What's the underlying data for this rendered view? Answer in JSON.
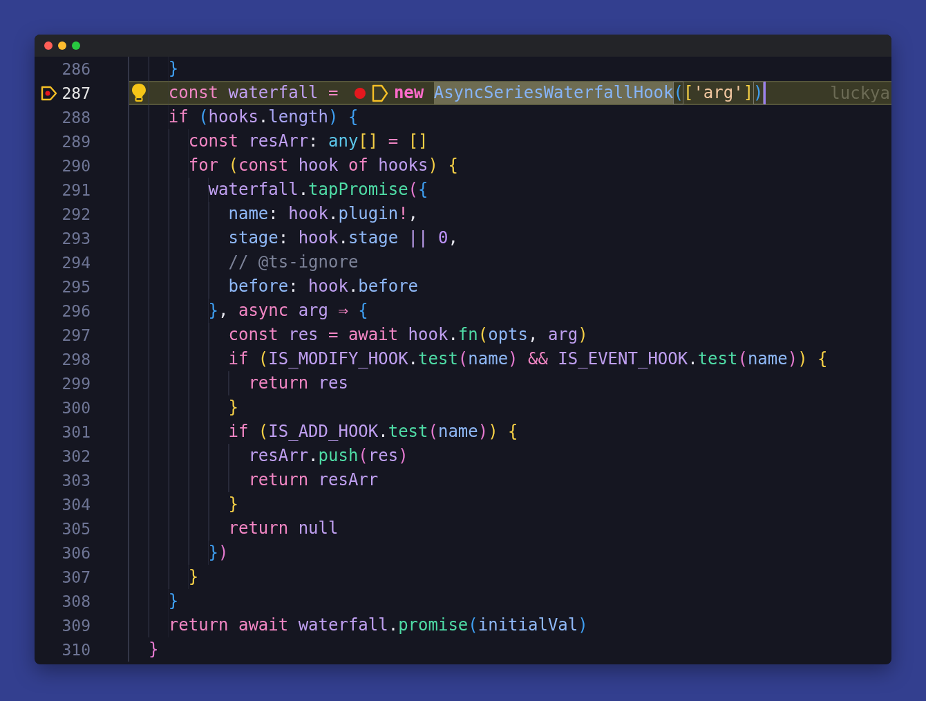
{
  "window": {
    "controls": [
      {
        "kind": "close"
      },
      {
        "kind": "minimize"
      },
      {
        "kind": "maximize"
      }
    ]
  },
  "editor": {
    "lines": [
      {
        "number": "286",
        "current": false,
        "tokens": [
          {
            "text": "    }",
            "kind": "b3"
          }
        ]
      },
      {
        "number": "287",
        "current": true,
        "breakpoint": true,
        "lightbulb": true,
        "blame": "luckya",
        "tokens": [
          {
            "text": "    const ",
            "kind": "kw"
          },
          {
            "text": "waterfall ",
            "kind": "var"
          },
          {
            "text": "= ",
            "kind": "op"
          },
          {
            "kind": "breakpoint-dot"
          },
          {
            "kind": "tag-marker"
          },
          {
            "text": "new ",
            "kind": "new"
          },
          {
            "text": "AsyncSeriesWaterfallHook",
            "kind": "cls",
            "selected": true
          },
          {
            "text": "(",
            "kind": "b3",
            "matched": true
          },
          {
            "text": "[",
            "kind": "b1"
          },
          {
            "text": "'arg'",
            "kind": "str"
          },
          {
            "text": "]",
            "kind": "b1"
          },
          {
            "text": ")",
            "kind": "b3",
            "matched": true,
            "cursor": true
          }
        ]
      },
      {
        "number": "288",
        "current": false,
        "tokens": [
          {
            "text": "    if ",
            "kind": "kw"
          },
          {
            "text": "(",
            "kind": "b3"
          },
          {
            "text": "hooks",
            "kind": "var"
          },
          {
            "text": ".",
            "kind": "p"
          },
          {
            "text": "length",
            "kind": "prop"
          },
          {
            "text": ") ",
            "kind": "b3"
          },
          {
            "text": "{",
            "kind": "b3"
          }
        ]
      },
      {
        "number": "289",
        "current": false,
        "tokens": [
          {
            "text": "      const ",
            "kind": "kw"
          },
          {
            "text": "resArr",
            "kind": "var"
          },
          {
            "text": ": ",
            "kind": "p"
          },
          {
            "text": "any",
            "kind": "type"
          },
          {
            "text": "[] ",
            "kind": "b1"
          },
          {
            "text": "= ",
            "kind": "op"
          },
          {
            "text": "[]",
            "kind": "b1"
          }
        ]
      },
      {
        "number": "290",
        "current": false,
        "tokens": [
          {
            "text": "      for ",
            "kind": "kw"
          },
          {
            "text": "(",
            "kind": "b1"
          },
          {
            "text": "const ",
            "kind": "kw"
          },
          {
            "text": "hook ",
            "kind": "var"
          },
          {
            "text": "of ",
            "kind": "kw"
          },
          {
            "text": "hooks",
            "kind": "var"
          },
          {
            "text": ") ",
            "kind": "b1"
          },
          {
            "text": "{",
            "kind": "b1"
          }
        ]
      },
      {
        "number": "291",
        "current": false,
        "tokens": [
          {
            "text": "        waterfall",
            "kind": "var"
          },
          {
            "text": ".",
            "kind": "p"
          },
          {
            "text": "tapPromise",
            "kind": "fn"
          },
          {
            "text": "(",
            "kind": "b2"
          },
          {
            "text": "{",
            "kind": "b3"
          }
        ]
      },
      {
        "number": "292",
        "current": false,
        "tokens": [
          {
            "text": "          name",
            "kind": "key"
          },
          {
            "text": ": ",
            "kind": "p"
          },
          {
            "text": "hook",
            "kind": "var"
          },
          {
            "text": ".",
            "kind": "p"
          },
          {
            "text": "plugin",
            "kind": "key"
          },
          {
            "text": "!",
            "kind": "op"
          },
          {
            "text": ",",
            "kind": "p"
          }
        ]
      },
      {
        "number": "293",
        "current": false,
        "tokens": [
          {
            "text": "          stage",
            "kind": "key"
          },
          {
            "text": ": ",
            "kind": "p"
          },
          {
            "text": "hook",
            "kind": "var"
          },
          {
            "text": ".",
            "kind": "p"
          },
          {
            "text": "stage ",
            "kind": "key"
          },
          {
            "text": "|| ",
            "kind": "var"
          },
          {
            "text": "0",
            "kind": "num"
          },
          {
            "text": ",",
            "kind": "p"
          }
        ]
      },
      {
        "number": "294",
        "current": false,
        "tokens": [
          {
            "text": "          // @ts-ignore",
            "kind": "cmt"
          }
        ]
      },
      {
        "number": "295",
        "current": false,
        "tokens": [
          {
            "text": "          before",
            "kind": "key"
          },
          {
            "text": ": ",
            "kind": "p"
          },
          {
            "text": "hook",
            "kind": "var"
          },
          {
            "text": ".",
            "kind": "p"
          },
          {
            "text": "before",
            "kind": "key"
          }
        ]
      },
      {
        "number": "296",
        "current": false,
        "tokens": [
          {
            "text": "        }",
            "kind": "b3"
          },
          {
            "text": ", ",
            "kind": "p"
          },
          {
            "text": "async ",
            "kind": "kw"
          },
          {
            "text": "arg ",
            "kind": "var"
          },
          {
            "text": "⇒ ",
            "kind": "op"
          },
          {
            "text": "{",
            "kind": "b3"
          }
        ]
      },
      {
        "number": "297",
        "current": false,
        "tokens": [
          {
            "text": "          const ",
            "kind": "kw"
          },
          {
            "text": "res ",
            "kind": "var"
          },
          {
            "text": "= ",
            "kind": "op"
          },
          {
            "text": "await ",
            "kind": "kw"
          },
          {
            "text": "hook",
            "kind": "var"
          },
          {
            "text": ".",
            "kind": "p"
          },
          {
            "text": "fn",
            "kind": "fn"
          },
          {
            "text": "(",
            "kind": "b1"
          },
          {
            "text": "opts",
            "kind": "key"
          },
          {
            "text": ", ",
            "kind": "p"
          },
          {
            "text": "arg",
            "kind": "var"
          },
          {
            "text": ")",
            "kind": "b1"
          }
        ]
      },
      {
        "number": "298",
        "current": false,
        "tokens": [
          {
            "text": "          if ",
            "kind": "kw"
          },
          {
            "text": "(",
            "kind": "b1"
          },
          {
            "text": "IS_MODIFY_HOOK",
            "kind": "var"
          },
          {
            "text": ".",
            "kind": "p"
          },
          {
            "text": "test",
            "kind": "fn"
          },
          {
            "text": "(",
            "kind": "b2"
          },
          {
            "text": "name",
            "kind": "key"
          },
          {
            "text": ") ",
            "kind": "b2"
          },
          {
            "text": "&& ",
            "kind": "op"
          },
          {
            "text": "IS_EVENT_HOOK",
            "kind": "var"
          },
          {
            "text": ".",
            "kind": "p"
          },
          {
            "text": "test",
            "kind": "fn"
          },
          {
            "text": "(",
            "kind": "b2"
          },
          {
            "text": "name",
            "kind": "key"
          },
          {
            "text": ")",
            "kind": "b2"
          },
          {
            "text": ") ",
            "kind": "b1"
          },
          {
            "text": "{",
            "kind": "b1"
          }
        ]
      },
      {
        "number": "299",
        "current": false,
        "tokens": [
          {
            "text": "            return ",
            "kind": "kw"
          },
          {
            "text": "res",
            "kind": "var"
          }
        ]
      },
      {
        "number": "300",
        "current": false,
        "tokens": [
          {
            "text": "          }",
            "kind": "b1"
          }
        ]
      },
      {
        "number": "301",
        "current": false,
        "tokens": [
          {
            "text": "          if ",
            "kind": "kw"
          },
          {
            "text": "(",
            "kind": "b1"
          },
          {
            "text": "IS_ADD_HOOK",
            "kind": "var"
          },
          {
            "text": ".",
            "kind": "p"
          },
          {
            "text": "test",
            "kind": "fn"
          },
          {
            "text": "(",
            "kind": "b2"
          },
          {
            "text": "name",
            "kind": "key"
          },
          {
            "text": ")",
            "kind": "b2"
          },
          {
            "text": ") ",
            "kind": "b1"
          },
          {
            "text": "{",
            "kind": "b1"
          }
        ]
      },
      {
        "number": "302",
        "current": false,
        "tokens": [
          {
            "text": "            resArr",
            "kind": "var"
          },
          {
            "text": ".",
            "kind": "p"
          },
          {
            "text": "push",
            "kind": "fn"
          },
          {
            "text": "(",
            "kind": "b2"
          },
          {
            "text": "res",
            "kind": "var"
          },
          {
            "text": ")",
            "kind": "b2"
          }
        ]
      },
      {
        "number": "303",
        "current": false,
        "tokens": [
          {
            "text": "            return ",
            "kind": "kw"
          },
          {
            "text": "resArr",
            "kind": "var"
          }
        ]
      },
      {
        "number": "304",
        "current": false,
        "tokens": [
          {
            "text": "          }",
            "kind": "b1"
          }
        ]
      },
      {
        "number": "305",
        "current": false,
        "tokens": [
          {
            "text": "          return ",
            "kind": "kw"
          },
          {
            "text": "null",
            "kind": "var"
          }
        ]
      },
      {
        "number": "306",
        "current": false,
        "tokens": [
          {
            "text": "        }",
            "kind": "b3"
          },
          {
            "text": ")",
            "kind": "b2"
          }
        ]
      },
      {
        "number": "307",
        "current": false,
        "tokens": [
          {
            "text": "      }",
            "kind": "b1"
          }
        ]
      },
      {
        "number": "308",
        "current": false,
        "tokens": [
          {
            "text": "    }",
            "kind": "b3"
          }
        ]
      },
      {
        "number": "309",
        "current": false,
        "tokens": [
          {
            "text": "    return ",
            "kind": "kw"
          },
          {
            "text": "await ",
            "kind": "kw"
          },
          {
            "text": "waterfall",
            "kind": "var"
          },
          {
            "text": ".",
            "kind": "p"
          },
          {
            "text": "promise",
            "kind": "fn"
          },
          {
            "text": "(",
            "kind": "b3"
          },
          {
            "text": "initialVal",
            "kind": "key"
          },
          {
            "text": ")",
            "kind": "b3"
          }
        ]
      },
      {
        "number": "310",
        "current": false,
        "tokens": [
          {
            "text": "  }",
            "kind": "b2"
          }
        ]
      }
    ]
  }
}
